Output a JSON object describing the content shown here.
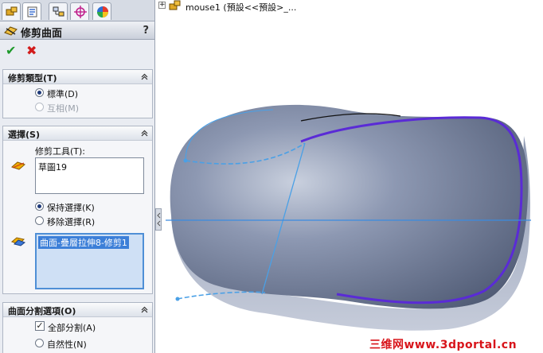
{
  "panel": {
    "title": "修剪曲面",
    "help": "?",
    "ok_glyph": "✔",
    "cancel_glyph": "✖"
  },
  "trim_type": {
    "header": "修剪類型(T)",
    "standard": "標準(D)",
    "mutual": "互相(M)"
  },
  "selections": {
    "header": "選擇(S)",
    "trim_tool_label": "修剪工具(T):",
    "trim_tool_value": "草圖19",
    "keep": "保持選擇(K)",
    "remove": "移除選擇(R)",
    "selected_item": "曲面-疊層拉伸8-修剪1"
  },
  "split": {
    "header": "曲面分割選項(O)",
    "split_all": "全部分割(A)",
    "natural": "自然性(N)",
    "check_mark": "✓"
  },
  "tree": {
    "expander": "+",
    "item": "mouse1 (預設<<預設>_..."
  },
  "watermark": "三维网www.3dportal.cn",
  "colors": {
    "surface": "#7d8aa6",
    "edge_highlight": "#5a2bd6",
    "sketch": "#4aa0e6"
  }
}
